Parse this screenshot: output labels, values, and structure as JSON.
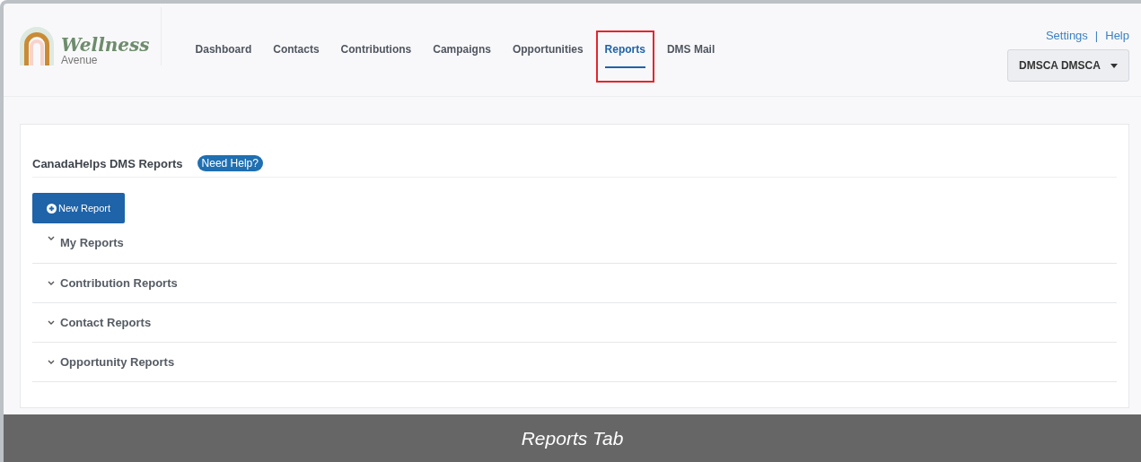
{
  "logo": {
    "title": "Wellness",
    "subtitle": "Avenue"
  },
  "tabs": [
    {
      "label": "Dashboard",
      "selected": false,
      "highlighted": false
    },
    {
      "label": "Contacts",
      "selected": false,
      "highlighted": false
    },
    {
      "label": "Contributions",
      "selected": false,
      "highlighted": false
    },
    {
      "label": "Campaigns",
      "selected": false,
      "highlighted": false
    },
    {
      "label": "Opportunities",
      "selected": false,
      "highlighted": false
    },
    {
      "label": "Reports",
      "selected": true,
      "highlighted": true
    },
    {
      "label": "DMS Mail",
      "selected": false,
      "highlighted": false
    }
  ],
  "top_links": [
    "Settings",
    "Help"
  ],
  "top_links_separator": "|",
  "user_menu": "DMSCA DMSCA",
  "panel": {
    "title": "CanadaHelps DMS Reports",
    "help_badge": "Need Help?",
    "new_button": "New Report",
    "sections": [
      {
        "label": "My Reports",
        "expanded": false
      },
      {
        "label": "Contribution Reports",
        "expanded": false
      },
      {
        "label": "Contact Reports",
        "expanded": false
      },
      {
        "label": "Opportunity Reports",
        "expanded": false
      }
    ]
  },
  "caption": "Reports Tab"
}
